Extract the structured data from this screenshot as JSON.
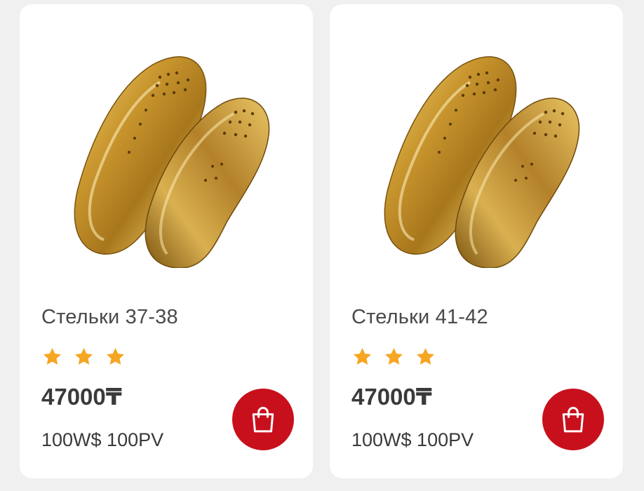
{
  "colors": {
    "background": "#f0f0f0",
    "card": "#ffffff",
    "accent": "#c8101d",
    "star": "#f5a623",
    "text": "#3a3a3a"
  },
  "products": [
    {
      "title": "Стельки 37-38",
      "rating": 3,
      "price": "47000₸",
      "points": "100W$ 100PV",
      "image_icon": "gold-insoles-image",
      "cart_icon": "shopping-bag-icon"
    },
    {
      "title": "Стельки 41-42",
      "rating": 3,
      "price": "47000₸",
      "points": "100W$ 100PV",
      "image_icon": "gold-insoles-image",
      "cart_icon": "shopping-bag-icon"
    }
  ]
}
